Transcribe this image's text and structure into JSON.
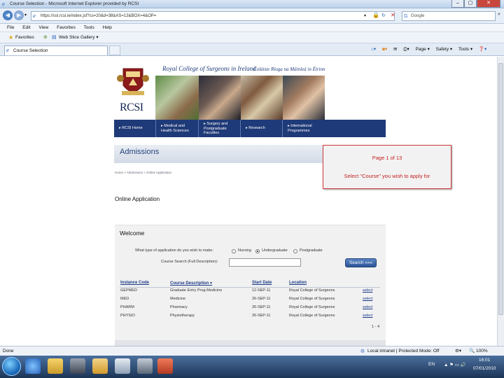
{
  "window": {
    "title": "Course Selection - Microsoft Internet Explorer provided by RCSI",
    "minimize": "–",
    "maximize": "▢",
    "close": "✕"
  },
  "address": {
    "url": "https://ssl.rcsi.ie/index.jsf?cs=20&d=38&AS=13&BOX=4&OP=",
    "search_placeholder": "Google"
  },
  "menu": [
    "File",
    "Edit",
    "View",
    "Favorites",
    "Tools",
    "Help"
  ],
  "favorites": {
    "label": "Favorites",
    "web_slice": "Web Slice Gallery ▾"
  },
  "tab": {
    "label": "Course Selection"
  },
  "command_bar": [
    "Page ▾",
    "Safety ▾",
    "Tools ▾",
    "❓▾"
  ],
  "site": {
    "college_name": "Royal College of Surgeons in Ireland",
    "irish_name": "Coláiste Ríoga na Máinleá in Éirinn",
    "logo_text": "RCSI",
    "nav": [
      "▸ RCSI Home",
      "▸ Medical and Health Sciences",
      "▸ Surgery and Postgraduate Faculties",
      "▸ Research",
      "▸ International Programmes"
    ],
    "section_title": "Admissions",
    "breadcrumb": "Home > Admissions > Online Application",
    "page_heading": "Online Application",
    "welcome": "Welcome",
    "question": "What type of application do you wish to make:",
    "options": [
      "Nursing",
      "Undergraduate",
      "Postgraduate"
    ],
    "selected_option": "Undergraduate",
    "search_label": "Course Search (Full Description):",
    "search_button": "Search »»»",
    "table": {
      "headers": [
        "Instance Code",
        "Course Description ▾",
        "Start Date",
        "Location"
      ],
      "rows": [
        [
          "GEPMED",
          "Graduate Entry Prog-Medicine",
          "12-SEP-11",
          "Royal College of Surgeons",
          "select"
        ],
        [
          "MED",
          "Medicine",
          "26-SEP-11",
          "Royal College of Surgeons",
          "select"
        ],
        [
          "PHARM",
          "Pharmacy",
          "26-SEP-11",
          "Royal College of Surgeons",
          "select"
        ],
        [
          "PHYSIO",
          "Physiotherapy",
          "26-SEP-11",
          "Royal College of Surgeons",
          "select"
        ]
      ]
    },
    "paging": "1 - 4"
  },
  "popup": {
    "line1": "Page 1 of 13",
    "line2": "Select \"Course\" you wish to apply for"
  },
  "status": {
    "left": "Done",
    "zone": "Local intranet | Protected Mode: Off",
    "zoom": "100%"
  },
  "tray": {
    "lang": "EN",
    "time": "16:01",
    "date": "07/01/2010"
  },
  "colors": {
    "nav_blue": "#1f3a78",
    "link_blue": "#1b3a86",
    "popup_border": "#d23a3a",
    "popup_text": "#c42121"
  }
}
